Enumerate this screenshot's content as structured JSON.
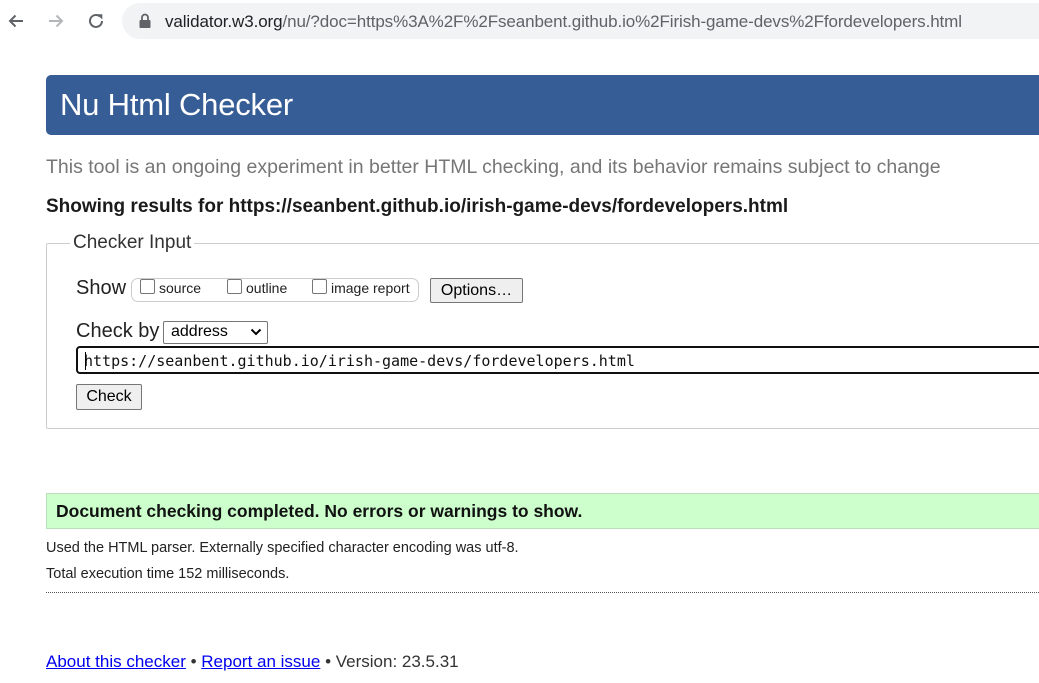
{
  "browser": {
    "url_host": "validator.w3.org",
    "url_rest": "/nu/?doc=https%3A%2F%2Fseanbent.github.io%2Firish-game-devs%2Ffordevelopers.html",
    "icons": {
      "back": "arrow-left-icon",
      "forward": "arrow-right-icon",
      "reload": "reload-icon",
      "security": "lock-icon"
    }
  },
  "header": {
    "title": "Nu Html Checker",
    "color": "#365d95"
  },
  "tagline": "This tool is an ongoing experiment in better HTML checking, and its behavior remains subject to change",
  "results_for": "Showing results for https://seanbent.github.io/irish-game-devs/fordevelopers.html",
  "checker_input": {
    "legend": "Checker Input",
    "show_label": "Show",
    "show_options": [
      {
        "label": "source",
        "checked": false
      },
      {
        "label": "outline",
        "checked": false
      },
      {
        "label": "image report",
        "checked": false
      }
    ],
    "options_button": "Options…",
    "check_by_label": "Check by",
    "check_by_value": "address",
    "url_value": "https://seanbent.github.io/irish-game-devs/fordevelopers.html",
    "check_button": "Check"
  },
  "result": {
    "message": "Document checking completed. No errors or warnings to show.",
    "color": "#ccffcc"
  },
  "info": {
    "parser": "Used the HTML parser. Externally specified character encoding was utf-8.",
    "time": "Total execution time 152 milliseconds."
  },
  "footer": {
    "about": "About this checker",
    "sep1": " • ",
    "report": "Report an issue",
    "sep2": " • ",
    "version": "Version: 23.5.31"
  }
}
